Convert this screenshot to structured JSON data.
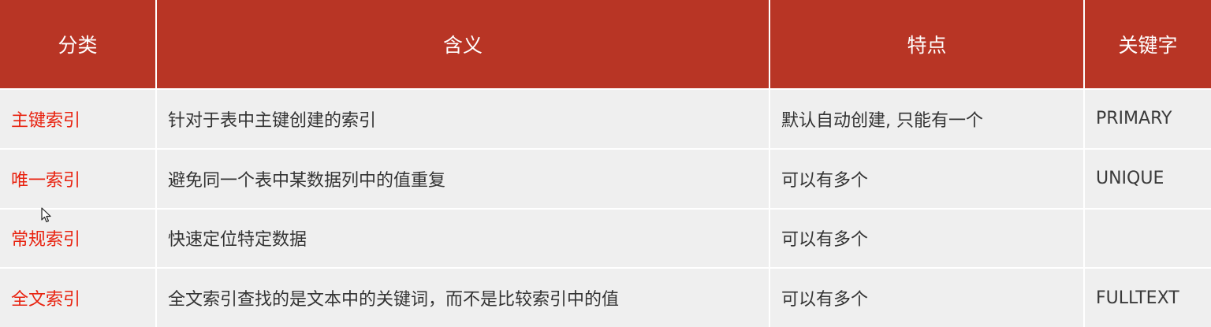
{
  "header": {
    "col_category": "分类",
    "col_meaning": "含义",
    "col_feature": "特点",
    "col_keyword": "关键字"
  },
  "rows": [
    {
      "category": "主键索引",
      "meaning": "针对于表中主键创建的索引",
      "feature": "默认自动创建, 只能有一个",
      "keyword": "PRIMARY"
    },
    {
      "category": "唯一索引",
      "meaning": "避免同一个表中某数据列中的值重复",
      "feature": "可以有多个",
      "keyword": "UNIQUE"
    },
    {
      "category": "常规索引",
      "meaning": "快速定位特定数据",
      "feature": "可以有多个",
      "keyword": ""
    },
    {
      "category": "全文索引",
      "meaning": "全文索引查找的是文本中的关键词，而不是比较索引中的值",
      "feature": "可以有多个",
      "keyword": "FULLTEXT"
    }
  ],
  "colors": {
    "header_bg": "#b83525",
    "category_text": "#e8220f",
    "row_bg": "#efefef"
  }
}
